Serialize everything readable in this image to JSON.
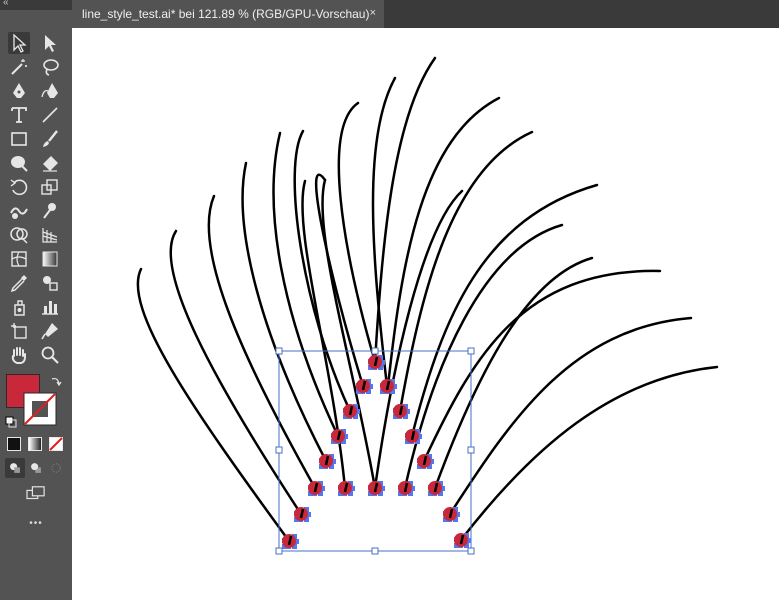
{
  "toolbar": {
    "collapse_label": "«",
    "fill_color": "#c8283a",
    "stroke_color": "#ffffff",
    "more_label": "•••",
    "tools": [
      {
        "name": "selection-tool-icon"
      },
      {
        "name": "direct-selection-tool-icon"
      },
      {
        "name": "magic-wand-tool-icon"
      },
      {
        "name": "lasso-tool-icon"
      },
      {
        "name": "pen-tool-icon"
      },
      {
        "name": "curvature-tool-icon"
      },
      {
        "name": "type-tool-icon"
      },
      {
        "name": "line-segment-tool-icon"
      },
      {
        "name": "rectangle-tool-icon"
      },
      {
        "name": "paintbrush-tool-icon"
      },
      {
        "name": "shaper-tool-icon"
      },
      {
        "name": "eraser-tool-icon"
      },
      {
        "name": "rotate-tool-icon"
      },
      {
        "name": "scale-tool-icon"
      },
      {
        "name": "warp-tool-icon"
      },
      {
        "name": "puppet-warp-tool-icon"
      },
      {
        "name": "shape-builder-tool-icon"
      },
      {
        "name": "perspective-grid-tool-icon"
      },
      {
        "name": "mesh-tool-icon"
      },
      {
        "name": "gradient-tool-icon"
      },
      {
        "name": "eyedropper-tool-icon"
      },
      {
        "name": "blend-tool-icon"
      },
      {
        "name": "symbol-sprayer-tool-icon"
      },
      {
        "name": "column-graph-tool-icon"
      },
      {
        "name": "artboard-tool-icon"
      },
      {
        "name": "slice-tool-icon"
      },
      {
        "name": "hand-tool-icon"
      },
      {
        "name": "zoom-tool-icon"
      }
    ]
  },
  "document_tab": {
    "title": "line_style_test.ai* bei 121.89 % (RGB/GPU-Vorschau)",
    "close_label": "×"
  },
  "canvas": {
    "stroke_color": "#000000",
    "anchor_color": "#c8283a",
    "handle_color": "#5577ee",
    "selection_color": "#4a6fc4"
  }
}
